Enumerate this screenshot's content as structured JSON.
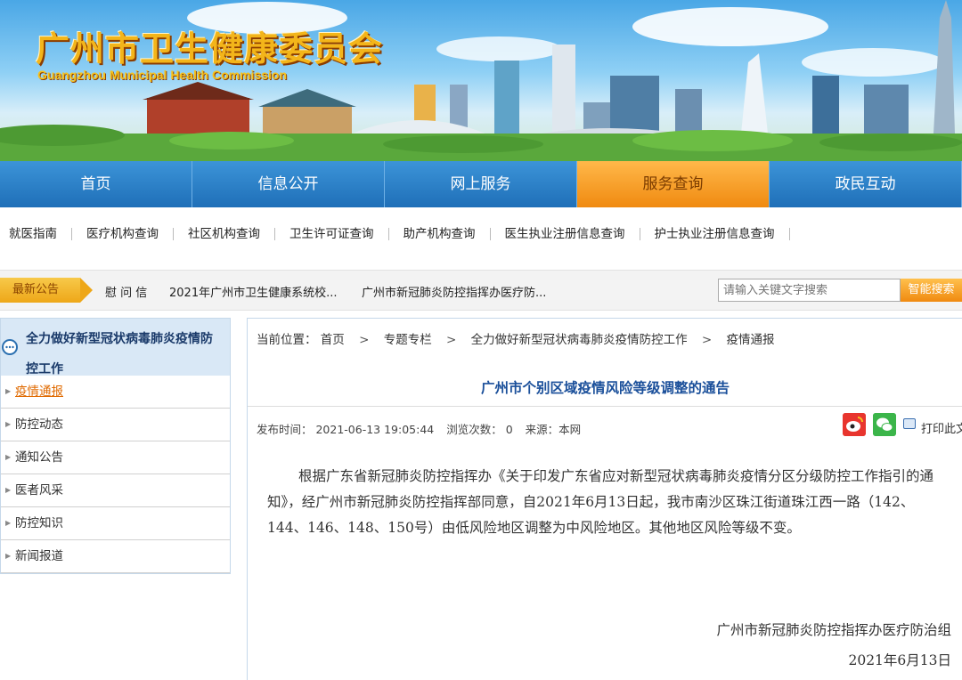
{
  "banner": {
    "title": "广州市卫生健康委员会",
    "subtitle": "Guangzhou Municipal Health Commission"
  },
  "main_nav": [
    {
      "label": "首页",
      "active": false
    },
    {
      "label": "信息公开",
      "active": false
    },
    {
      "label": "网上服务",
      "active": false
    },
    {
      "label": "服务查询",
      "active": true
    },
    {
      "label": "政民互动",
      "active": false
    }
  ],
  "sub_nav": [
    "就医指南",
    "医疗机构查询",
    "社区机构查询",
    "卫生许可证查询",
    "助产机构查询",
    "医生执业注册信息查询",
    "护士执业注册信息查询"
  ],
  "notice": {
    "tag": "最新公告",
    "items": [
      "慰 问 信",
      "2021年广州市卫生健康系统校...",
      "广州市新冠肺炎防控指挥办医疗防..."
    ]
  },
  "search": {
    "placeholder": "请输入关键文字搜索",
    "button": "智能搜索"
  },
  "sidebar": {
    "title": "全力做好新型冠状病毒肺炎疫情防控工作",
    "items": [
      {
        "label": "疫情通报",
        "active": true
      },
      {
        "label": "防控动态",
        "active": false
      },
      {
        "label": "通知公告",
        "active": false
      },
      {
        "label": "医者风采",
        "active": false
      },
      {
        "label": "防控知识",
        "active": false
      },
      {
        "label": "新闻报道",
        "active": false
      }
    ]
  },
  "breadcrumb": {
    "prefix": "当前位置：",
    "items": [
      "首页",
      "专题专栏",
      "全力做好新型冠状病毒肺炎疫情防控工作",
      "疫情通报"
    ],
    "separator": ">"
  },
  "article": {
    "title": "广州市个别区域疫情风险等级调整的通告",
    "meta": {
      "published": "发布时间：  2021-06-13 19:05:44",
      "views": "浏览次数：  0",
      "source": "来源：本网"
    },
    "print_label": "打印此文",
    "body": "根据广东省新冠肺炎防控指挥办《关于印发广东省应对新型冠状病毒肺炎疫情分区分级防控工作指引的通知》，经广州市新冠肺炎防控指挥部同意，自2021年6月13日起，我市南沙区珠江街道珠江西一路（142、144、146、148、150号）由低风险地区调整为中风险地区。其他地区风险等级不变。",
    "signature": "广州市新冠肺炎防控指挥办医疗防治组",
    "date": "2021年6月13日"
  },
  "colors": {
    "nav_blue": "#2a7fc8",
    "nav_active": "#f5a020",
    "title_blue": "#1a4f9a",
    "accent_orange": "#e06a00"
  }
}
